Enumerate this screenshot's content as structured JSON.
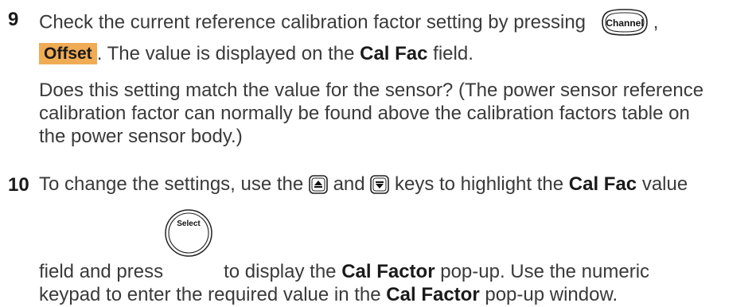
{
  "step9": {
    "number": "9",
    "line1_text": "Check the current reference calibration factor setting by pressing",
    "line1_tail": ",",
    "channel_key_label": "Channel",
    "offset_softkey": "Offset",
    "line2_text": ". The value is displayed on the",
    "cal_fac_field": "Cal Fac",
    "line2_tail": "field.",
    "paragraph_lines": [
      "Does this setting match the value for the sensor? (The power sensor reference",
      "calibration factor can normally be found above the calibration factors table on",
      "the power sensor body.)"
    ]
  },
  "step10": {
    "number": "10",
    "line1_a": "To change the settings, use the",
    "line1_b": "and",
    "line1_c": "keys to highlight the",
    "cal_fac_field": "Cal Fac",
    "line1_d": "value",
    "line2_a": "field and press",
    "select_key_label": "Select",
    "line2_b": "to display the",
    "cal_factor": "Cal Factor",
    "line2_c": "pop-up. Use the numeric",
    "line3_a": "keypad to enter the required value in the",
    "cal_factor_2": "Cal Factor",
    "line3_b": "pop-up window."
  }
}
